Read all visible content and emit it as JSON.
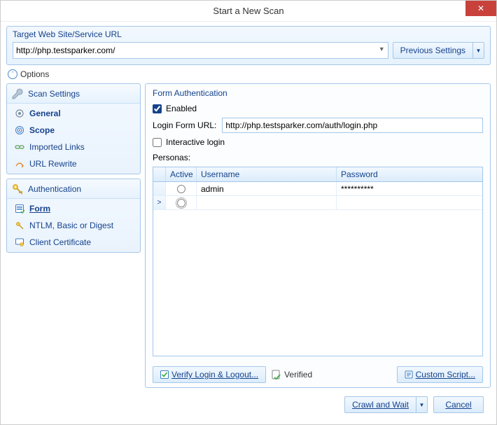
{
  "title": "Start a New Scan",
  "target_label": "Target Web Site/Service URL",
  "target_url": "http://php.testsparker.com/",
  "previous_settings": "Previous Settings",
  "options_label": "Options",
  "sidebar": {
    "scan": {
      "title": "Scan Settings",
      "items": [
        {
          "label": "General"
        },
        {
          "label": "Scope"
        },
        {
          "label": "Imported Links"
        },
        {
          "label": "URL Rewrite"
        }
      ]
    },
    "auth": {
      "title": "Authentication",
      "items": [
        {
          "label": "Form"
        },
        {
          "label": "NTLM, Basic or Digest"
        },
        {
          "label": "Client Certificate"
        }
      ]
    }
  },
  "form_auth": {
    "title": "Form Authentication",
    "enabled_label": "Enabled",
    "enabled": true,
    "login_url_label": "Login Form URL:",
    "login_url": "http://php.testsparker.com/auth/login.php",
    "interactive_label": "Interactive login",
    "interactive": false,
    "personas_label": "Personas:",
    "columns": {
      "active": "Active",
      "username": "Username",
      "password": "Password"
    },
    "rows": [
      {
        "marker": "",
        "username": "admin",
        "password": "**********"
      },
      {
        "marker": ">",
        "username": "",
        "password": ""
      }
    ],
    "verify_btn": "Verify Login & Logout...",
    "verified_label": "Verified",
    "custom_script_btn": "Custom Script..."
  },
  "footer": {
    "crawl": "Crawl and Wait",
    "cancel": "Cancel"
  }
}
